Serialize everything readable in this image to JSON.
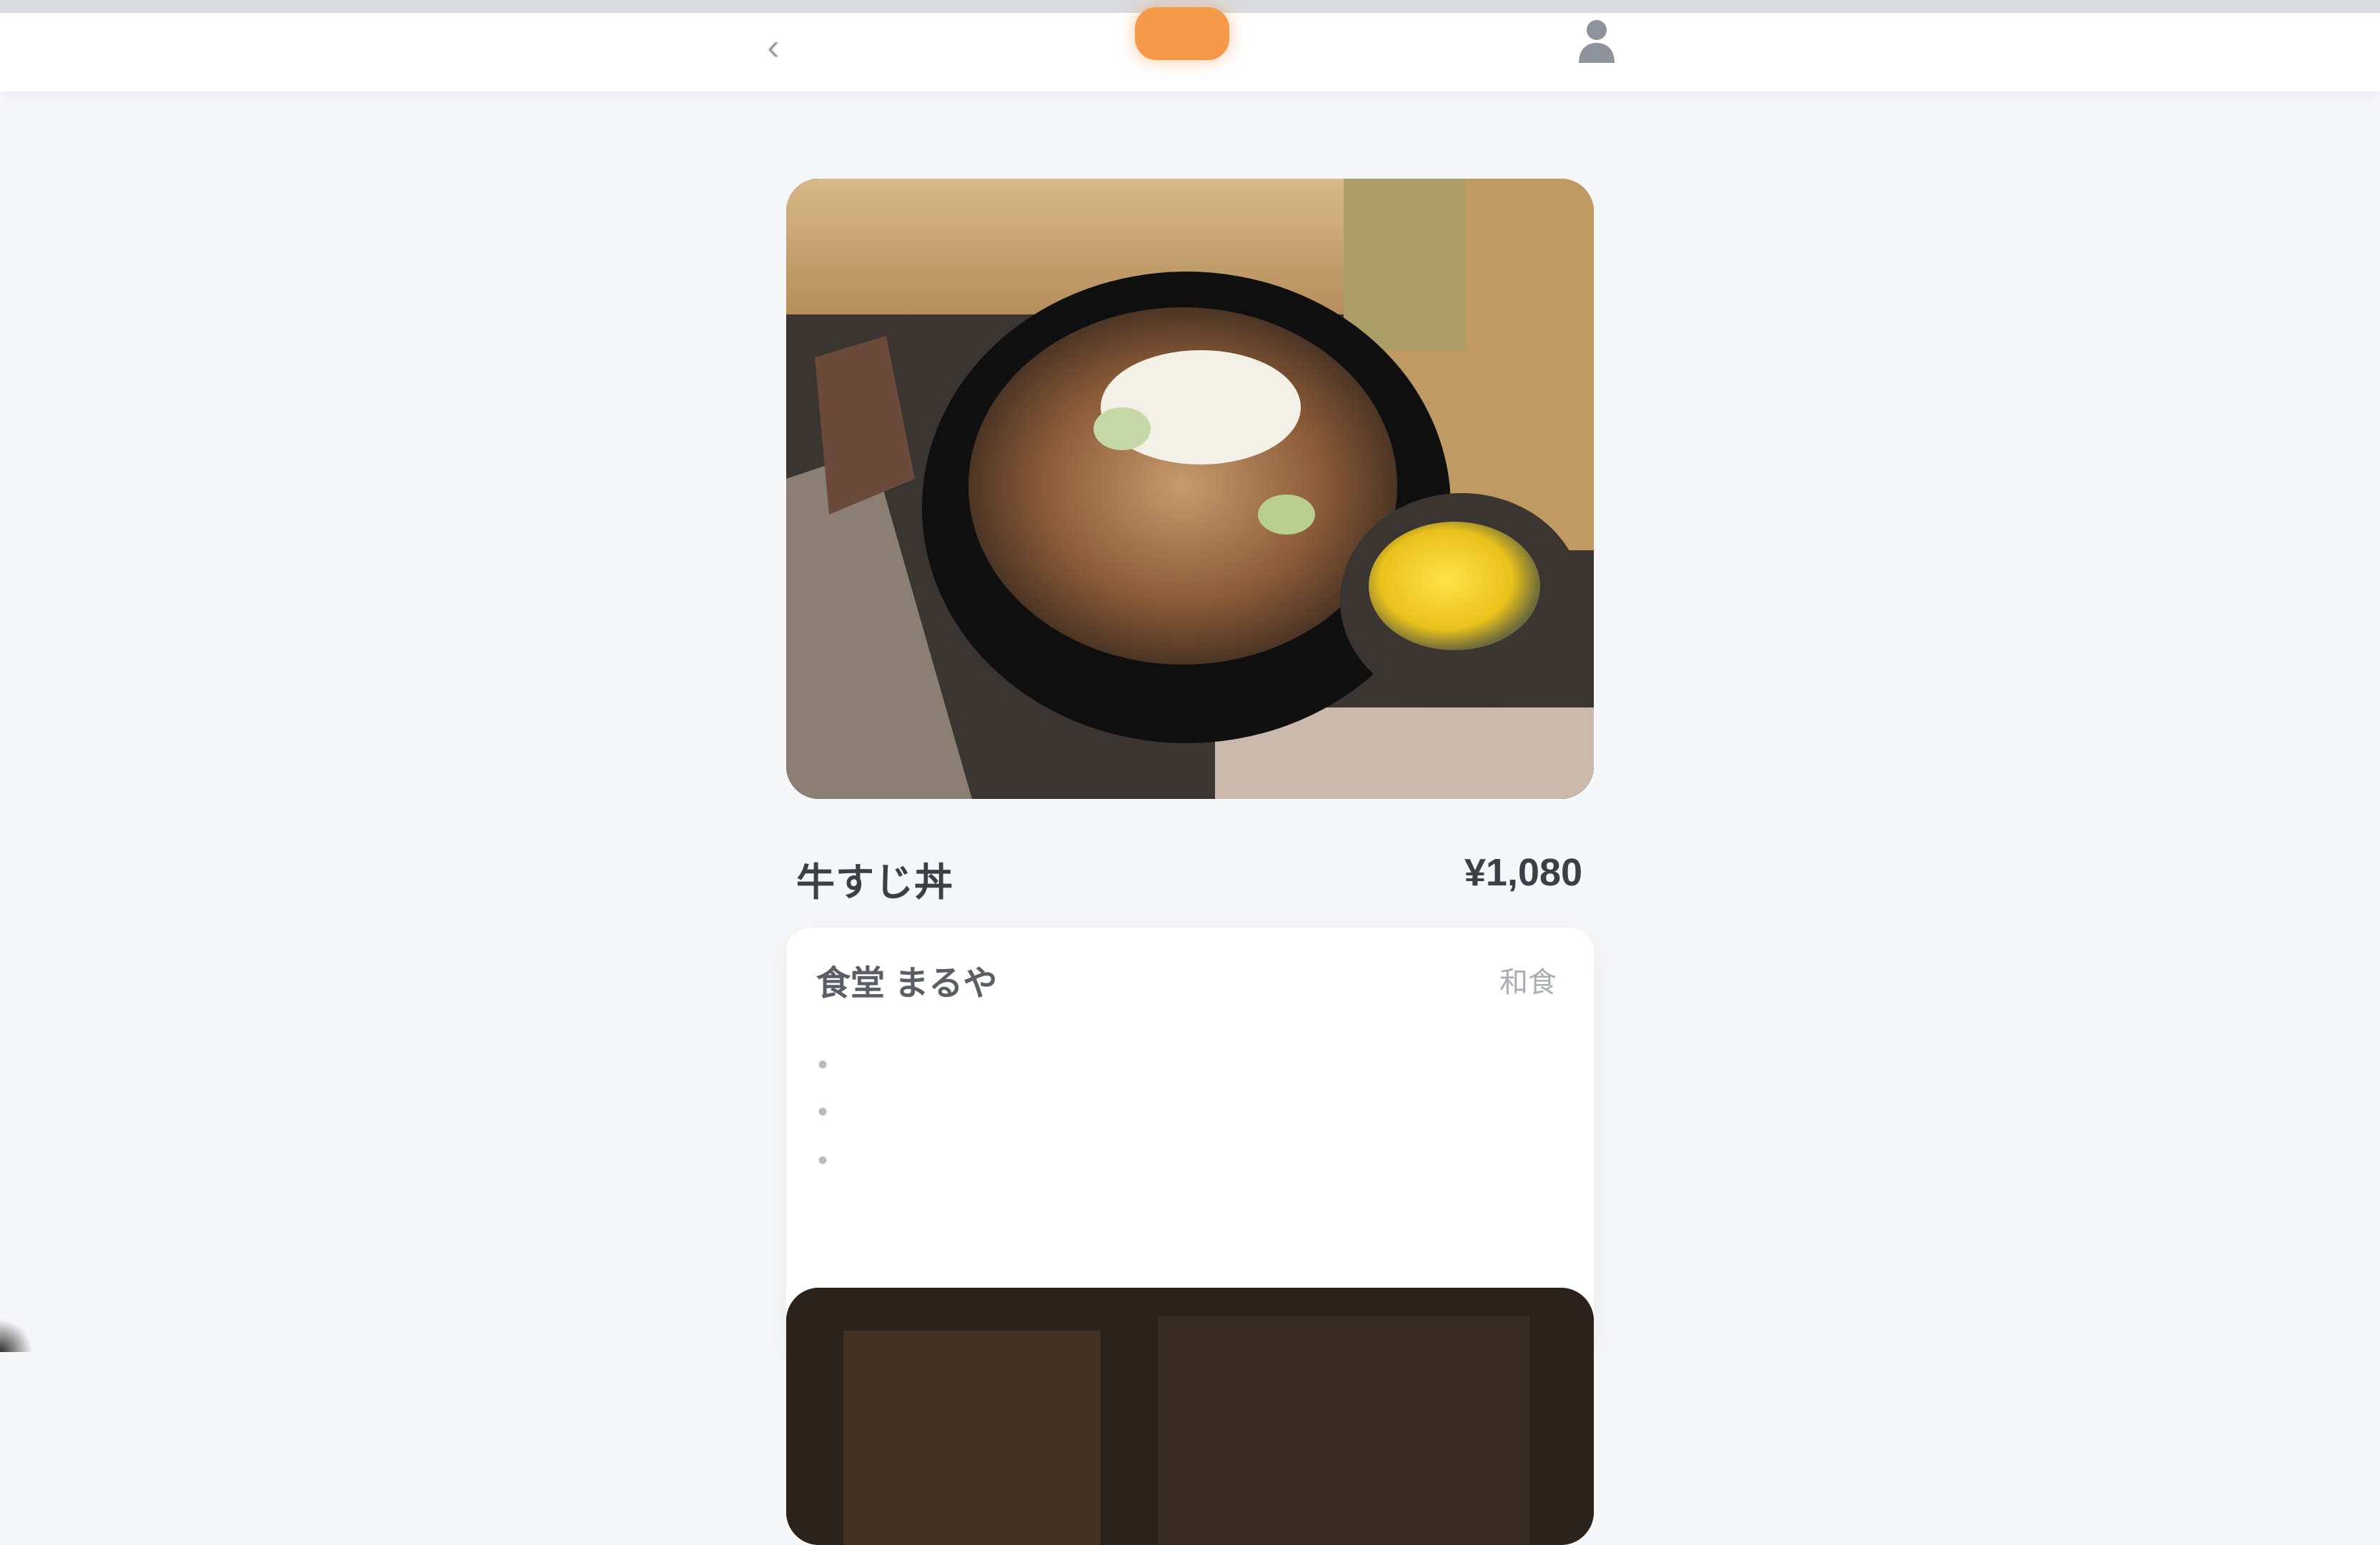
{
  "header": {
    "back_icon": "chevron-left-icon",
    "logo_color": "#f59a48",
    "user_icon": "user-icon"
  },
  "post": {
    "image": "food-photo-stone-bowl",
    "title": "牛すじ丼",
    "price": "¥1,080",
    "shop_name": "食堂 まるや",
    "tag": "和食",
    "lines": [
      "•",
      "•",
      "•"
    ]
  },
  "next_post": {
    "image": "food-photo-dark"
  },
  "colors": {
    "accent": "#f59a48",
    "background": "#f6f7f9",
    "card": "#ffffff"
  }
}
